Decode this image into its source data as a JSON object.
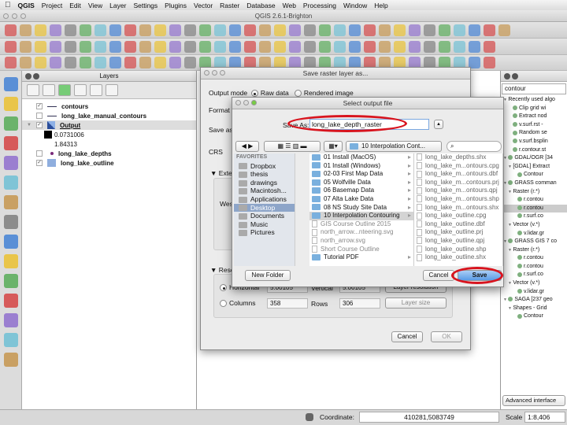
{
  "menubar": {
    "items": [
      "QGIS",
      "Project",
      "Edit",
      "View",
      "Layer",
      "Settings",
      "Plugins",
      "Vector",
      "Raster",
      "Database",
      "Web",
      "Processing",
      "Window",
      "Help"
    ]
  },
  "window": {
    "title": "QGIS 2.6.1-Brighton"
  },
  "layers_panel": {
    "title": "Layers",
    "items": [
      {
        "name": "contours",
        "checked": true,
        "symbol": "line"
      },
      {
        "name": "long_lake_manual_contours",
        "checked": false,
        "symbol": "line"
      },
      {
        "name": "Output",
        "checked": true,
        "symbol": "raster",
        "expanded": true
      },
      {
        "name": "long_lake_depths",
        "checked": false,
        "symbol": "point"
      },
      {
        "name": "long_lake_outline",
        "checked": true,
        "symbol": "polygon"
      }
    ],
    "output_legend": {
      "min": "0.0731006",
      "max": "1.84313"
    }
  },
  "save_raster": {
    "title": "Save raster layer as...",
    "output_mode_label": "Output mode",
    "raw_data": "Raw data",
    "rendered_image": "Rendered image",
    "output_mode": "Raw data",
    "format_label": "Format",
    "save_as_label": "Save as",
    "crs_label": "CRS",
    "extent_label": "Extent",
    "west_label": "West",
    "resolution_label": "Resolution",
    "horizontal_label": "Horizontal",
    "horizontal_value": "5.00105",
    "vertical_label": "Vertical",
    "vertical_value": "5.00105",
    "layer_resolution": "Layer resolution",
    "columns_label": "Columns",
    "columns_value": "358",
    "rows_label": "Rows",
    "rows_value": "306",
    "layer_size": "Layer size",
    "cancel": "Cancel",
    "ok": "OK"
  },
  "select_file": {
    "title": "Select output file",
    "save_as_label": "Save As:",
    "save_as_value": "long_lake_depth_raster",
    "location": "10 Interpolation Cont...",
    "search_placeholder": "",
    "favorites_label": "FAVORITES",
    "favorites": [
      "Dropbox",
      "thesis",
      "drawings",
      "Macintosh...",
      "Applications",
      "Desktop",
      "Documents",
      "Music",
      "Pictures"
    ],
    "selected_favorite": "Desktop",
    "folder_items": [
      {
        "name": "01 Install (MacOS)",
        "type": "folder"
      },
      {
        "name": "01 Install (Windows)",
        "type": "folder"
      },
      {
        "name": "02-03 First Map Data",
        "type": "folder"
      },
      {
        "name": "05 Wolfville Data",
        "type": "folder"
      },
      {
        "name": "06 Basemap Data",
        "type": "folder"
      },
      {
        "name": "07 Alta Lake Data",
        "type": "folder"
      },
      {
        "name": "08 NS Study Site Data",
        "type": "folder"
      },
      {
        "name": "10 Interpolation Contouring",
        "type": "folder",
        "selected": true
      },
      {
        "name": "GIS Course Outline 2015",
        "type": "file"
      },
      {
        "name": "north_arrow...nteering.svg",
        "type": "file"
      },
      {
        "name": "north_arrow.svg",
        "type": "file"
      },
      {
        "name": "Short Course Outline",
        "type": "file"
      },
      {
        "name": "Tutorial PDF",
        "type": "folder"
      }
    ],
    "files": [
      "long_lake_depths.shx",
      "long_lake_m...ontours.cpg",
      "long_lake_m...ontours.dbf",
      "long_lake_m...contours.prj",
      "long_lake_m...ontours.qpj",
      "long_lake_m...ontours.shp",
      "long_lake_m...ontours.shx",
      "long_lake_outline.cpg",
      "long_lake_outline.dbf",
      "long_lake_outline.prj",
      "long_lake_outline.qpj",
      "long_lake_outline.shp",
      "long_lake_outline.shx"
    ],
    "new_folder": "New Folder",
    "cancel": "Cancel",
    "save": "Save"
  },
  "processing": {
    "search_value": "contour",
    "tree": [
      {
        "t": "Recently used algo",
        "d": 0
      },
      {
        "t": "Clip grid wi",
        "d": 2
      },
      {
        "t": "Extract nod",
        "d": 2
      },
      {
        "t": "v.surf.rst - ",
        "d": 2
      },
      {
        "t": "Random se",
        "d": 2
      },
      {
        "t": "v.surf.bsplin",
        "d": 2
      },
      {
        "t": "r.contour.st",
        "d": 2
      },
      {
        "t": "GDAL/OGR [34",
        "d": 0
      },
      {
        "t": "[GDAL] Extract",
        "d": 1
      },
      {
        "t": "Contour",
        "d": 3
      },
      {
        "t": "GRASS comman",
        "d": 0
      },
      {
        "t": "Raster (r.*)",
        "d": 1
      },
      {
        "t": "r.contou",
        "d": 3
      },
      {
        "t": "r.contou",
        "d": 3,
        "sel": true
      },
      {
        "t": "r.surf.co",
        "d": 3
      },
      {
        "t": "Vector (v.*)",
        "d": 1
      },
      {
        "t": "v.lidar.gr",
        "d": 3
      },
      {
        "t": "GRASS GIS 7 co",
        "d": 0
      },
      {
        "t": "Raster (r.*)",
        "d": 1
      },
      {
        "t": "r.contou",
        "d": 3
      },
      {
        "t": "r.contou",
        "d": 3
      },
      {
        "t": "r.surf.co",
        "d": 3
      },
      {
        "t": "Vector (v.*)",
        "d": 1
      },
      {
        "t": "v.lidar.gr",
        "d": 3
      },
      {
        "t": "SAGA [237 geo",
        "d": 0
      },
      {
        "t": "Shapes - Grid",
        "d": 1
      },
      {
        "t": "Contour",
        "d": 3
      }
    ],
    "advanced_interface": "Advanced interface"
  },
  "status": {
    "coordinate_label": "Coordinate:",
    "coordinate_value": "410281,5083749",
    "scale_label": "Scale",
    "scale_value": "1:8,406"
  },
  "colors": {
    "highlight": "#d8141e",
    "accent": "#3f8fe6",
    "selection": "#c8c8c8"
  }
}
